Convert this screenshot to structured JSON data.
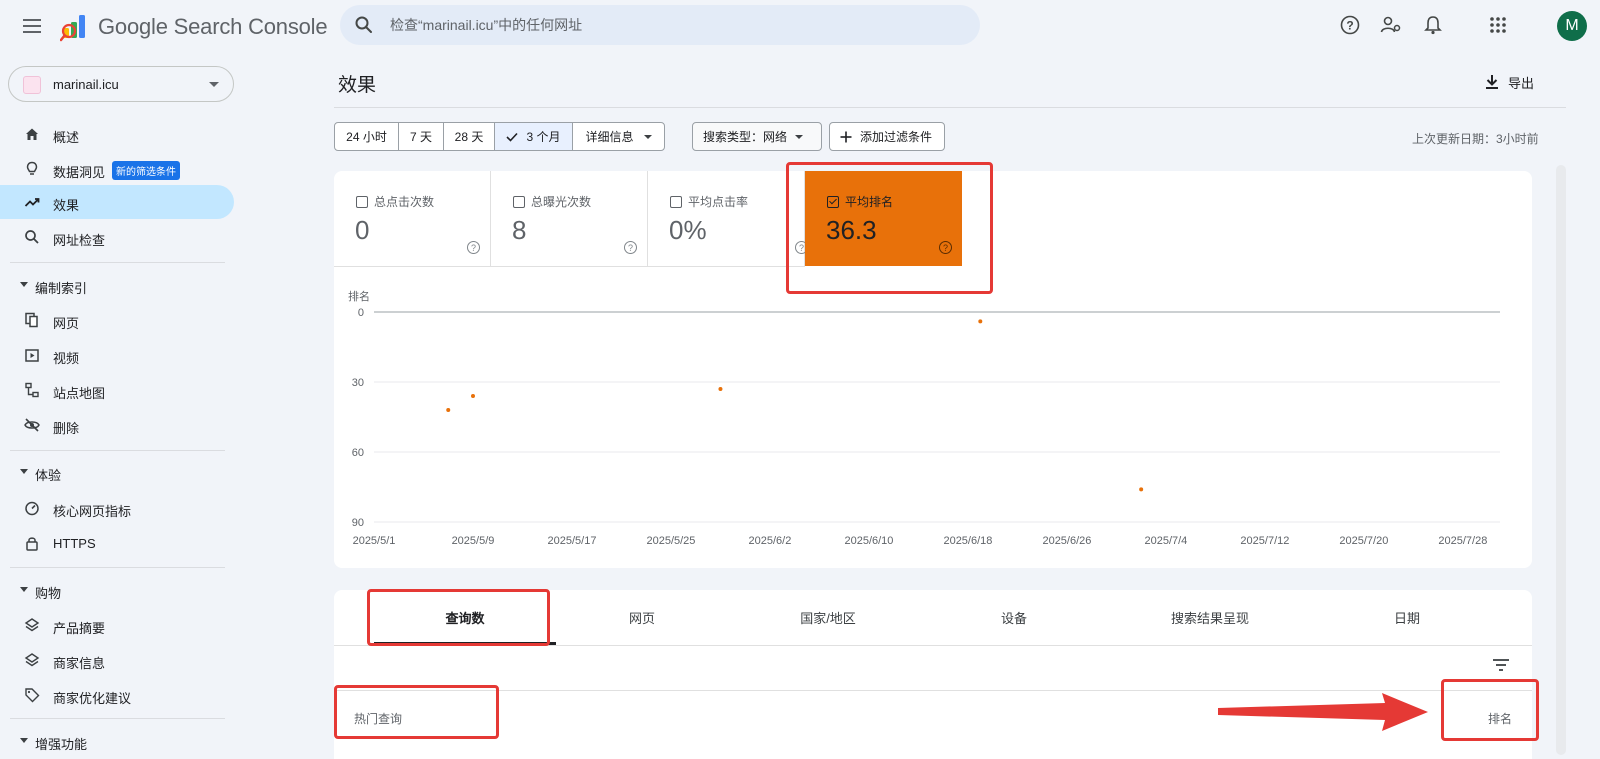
{
  "app": {
    "product_name": "Google Search Console",
    "search_placeholder": "检查“marinail.icu”中的任何网址",
    "avatar_letter": "M"
  },
  "sidebar": {
    "property": "marinail.icu",
    "items": [
      {
        "label": "概述",
        "icon": "home-icon"
      },
      {
        "label": "数据洞见",
        "icon": "lightbulb-icon",
        "badge": "新的筛选条件"
      },
      {
        "label": "效果",
        "icon": "trending-icon",
        "active": true
      },
      {
        "label": "网址检查",
        "icon": "search-icon"
      }
    ],
    "sections": [
      {
        "title": "编制索引",
        "items": [
          {
            "label": "网页",
            "icon": "pages-icon"
          },
          {
            "label": "视频",
            "icon": "video-icon"
          },
          {
            "label": "站点地图",
            "icon": "sitemap-icon"
          },
          {
            "label": "删除",
            "icon": "eye-off-icon"
          }
        ]
      },
      {
        "title": "体验",
        "items": [
          {
            "label": "核心网页指标",
            "icon": "speed-icon"
          },
          {
            "label": "HTTPS",
            "icon": "lock-icon"
          }
        ]
      },
      {
        "title": "购物",
        "items": [
          {
            "label": "产品摘要",
            "icon": "layers-icon"
          },
          {
            "label": "商家信息",
            "icon": "layers-icon"
          },
          {
            "label": "商家优化建议",
            "icon": "tag-icon"
          }
        ]
      },
      {
        "title": "增强功能",
        "items": []
      }
    ]
  },
  "main": {
    "title": "效果",
    "export_label": "导出",
    "date_ranges": [
      "24 小时",
      "7 天",
      "28 天",
      "3 个月",
      "详细信息"
    ],
    "selected_range": "3 个月",
    "search_type_label": "搜索类型：网络",
    "add_filter_label": "添加过滤条件",
    "last_updated": "上次更新日期：3小时前"
  },
  "metrics": [
    {
      "label": "总点击次数",
      "value": "0",
      "checked": false
    },
    {
      "label": "总曝光次数",
      "value": "8",
      "checked": false
    },
    {
      "label": "平均点击率",
      "value": "0%",
      "checked": false
    },
    {
      "label": "平均排名",
      "value": "36.3",
      "checked": true,
      "color": "#e8710a"
    }
  ],
  "chart_data": {
    "type": "scatter",
    "ylabel": "排名",
    "y_inverted": true,
    "ylim": [
      0,
      90
    ],
    "yticks": [
      "0",
      "30",
      "60",
      "90"
    ],
    "xticks": [
      "2025/5/1",
      "2025/5/9",
      "2025/5/17",
      "2025/5/25",
      "2025/6/2",
      "2025/6/10",
      "2025/6/18",
      "2025/6/26",
      "2025/7/4",
      "2025/7/12",
      "2025/7/20",
      "2025/7/28"
    ],
    "xlim": [
      "2025/5/1",
      "2025/7/31"
    ],
    "series": [
      {
        "color": "#e8710a",
        "points": [
          {
            "x": "2025/5/7",
            "y": 42
          },
          {
            "x": "2025/5/9",
            "y": 36
          },
          {
            "x": "2025/5/29",
            "y": 33
          },
          {
            "x": "2025/6/19",
            "y": 4
          },
          {
            "x": "2025/7/2",
            "y": 76
          }
        ]
      }
    ]
  },
  "table": {
    "tabs": [
      "查询数",
      "网页",
      "国家/地区",
      "设备",
      "搜索结果呈现",
      "日期"
    ],
    "active_tab": "查询数",
    "col_left": "热门查询",
    "col_right": "排名"
  },
  "colors": {
    "accent": "#e8710a",
    "annotation": "#e53935",
    "active_nav": "#c2e7ff"
  }
}
